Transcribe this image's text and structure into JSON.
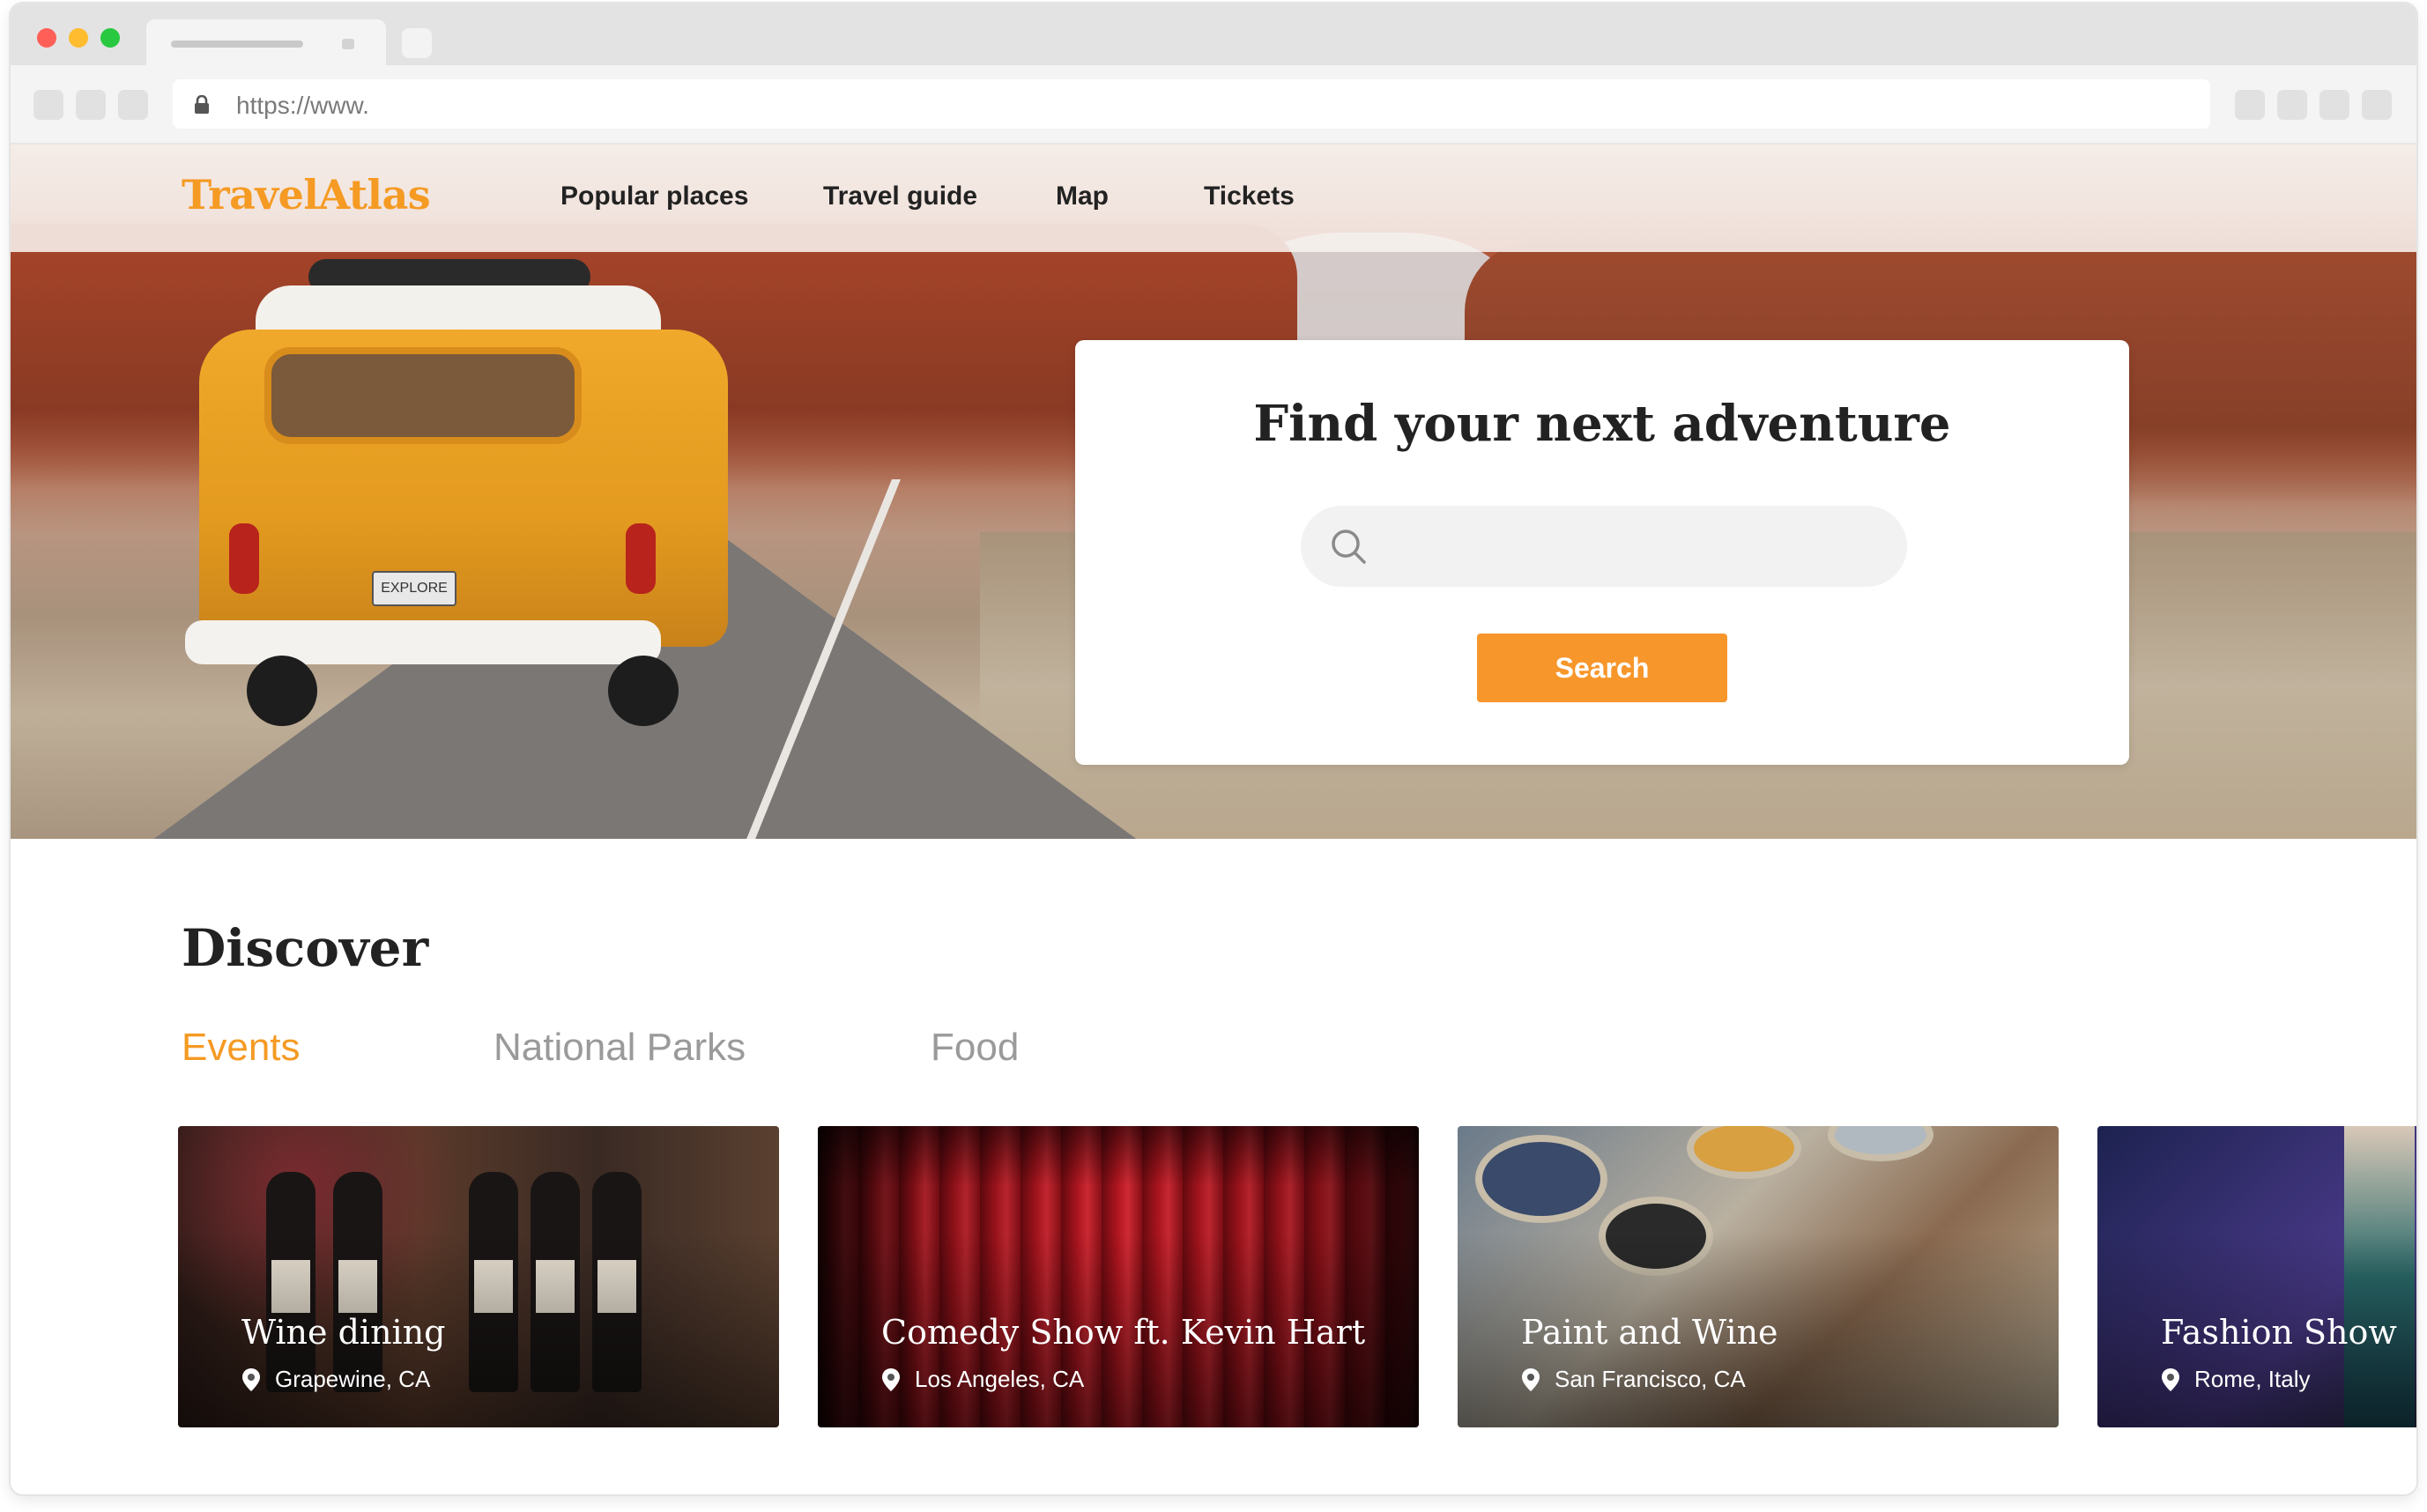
{
  "browser": {
    "url": "https://www."
  },
  "nav": {
    "logo": "TravelAtlas",
    "links": [
      "Popular places",
      "Travel guide",
      "Map",
      "Tickets"
    ]
  },
  "hero": {
    "heading": "Find your next adventure",
    "search_value": "",
    "search_button": "Search",
    "van_plate": "EXPLORE"
  },
  "discover": {
    "title": "Discover",
    "tabs": [
      "Events",
      "National Parks",
      "Food"
    ],
    "active_tab": "Events",
    "cards": [
      {
        "title": "Wine dining",
        "location": "Grapewine, CA"
      },
      {
        "title": "Comedy Show ft. Kevin Hart",
        "location": "Los Angeles, CA"
      },
      {
        "title": "Paint and Wine",
        "location": "San Francisco, CA"
      },
      {
        "title": "Fashion Show",
        "location": "Rome, Italy"
      }
    ]
  },
  "colors": {
    "accent": "#f59a23",
    "button": "#f7962b",
    "text": "#222222",
    "muted": "#9a9a9a"
  },
  "icons": [
    "lock-icon",
    "search-icon",
    "location-pin-icon"
  ]
}
